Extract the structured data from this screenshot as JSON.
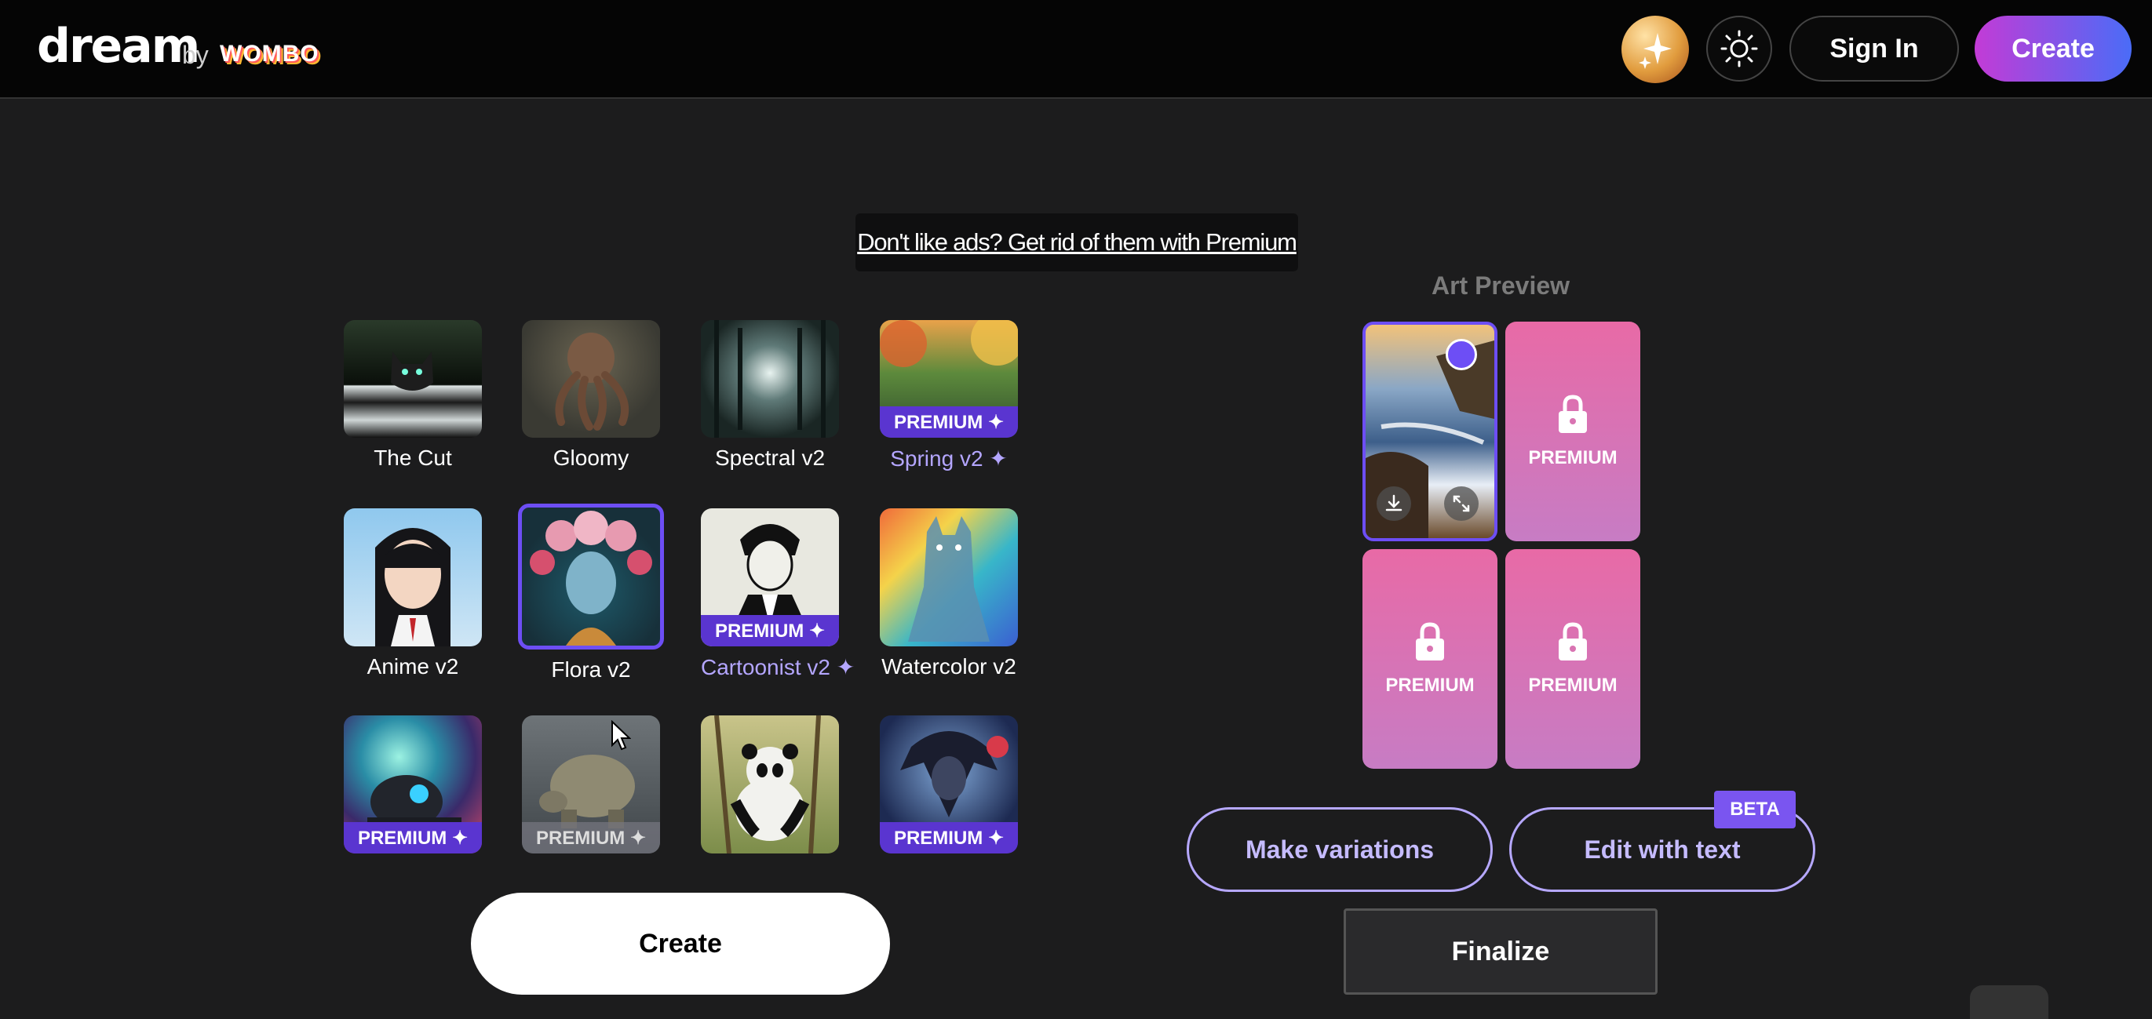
{
  "header": {
    "logo_main": "dream",
    "logo_by": "by",
    "logo_brand": "WOMBO",
    "sign_in_label": "Sign In",
    "create_label": "Create"
  },
  "ad_banner": {
    "text": "Don't like ads? Get rid of them with Premium"
  },
  "styles": [
    {
      "name": "The Cut",
      "premium": false,
      "band": ""
    },
    {
      "name": "Gloomy",
      "premium": false,
      "band": ""
    },
    {
      "name": "Spectral v2",
      "premium": false,
      "band": ""
    },
    {
      "name": "Spring v2 ✦",
      "premium": true,
      "band": "PREMIUM ✦"
    },
    {
      "name": "Anime v2",
      "premium": false,
      "band": ""
    },
    {
      "name": "Flora v2",
      "premium": false,
      "band": "",
      "selected": true
    },
    {
      "name": "Cartoonist v2 ✦",
      "premium": true,
      "band": "PREMIUM ✦"
    },
    {
      "name": "Watercolor v2",
      "premium": false,
      "band": ""
    },
    {
      "name": "",
      "premium": true,
      "band": "PREMIUM ✦"
    },
    {
      "name": "",
      "premium": true,
      "band": "PREMIUM ✦"
    },
    {
      "name": "",
      "premium": false,
      "band": ""
    },
    {
      "name": "",
      "premium": true,
      "band": "PREMIUM ✦"
    }
  ],
  "create_button": "Create",
  "art_preview": {
    "title": "Art Preview",
    "locked_label": "PREMIUM"
  },
  "actions": {
    "make_variations": "Make variations",
    "edit_with_text": "Edit with text",
    "beta_badge": "BETA",
    "finalize": "Finalize"
  },
  "icons": {
    "avatar": "sparkle-avatar-icon",
    "theme": "sun-icon",
    "lock": "lock-icon",
    "download": "download-icon",
    "expand": "expand-icon"
  },
  "colors": {
    "accent": "#6d4ef5",
    "premium_band": "#5a35d0",
    "premium_text": "#b4a6ff",
    "create_gradient_start": "#c33bd6",
    "create_gradient_end": "#4a6cf7",
    "locked_tile": "#e86aa6"
  }
}
